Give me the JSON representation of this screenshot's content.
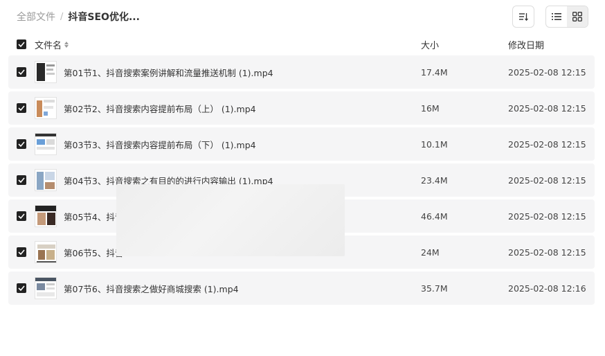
{
  "breadcrumb": {
    "root": "全部文件",
    "separator": "/",
    "current": "抖音SEO优化..."
  },
  "toolbar": {
    "sort_icon": "sort-list-icon",
    "list_icon": "list-view-icon",
    "grid_icon": "grid-view-icon"
  },
  "columns": {
    "name": "文件名",
    "size": "大小",
    "modified": "修改日期"
  },
  "files": [
    {
      "name": "第01节1、抖音搜索案例讲解和流量推送机制 (1).mp4",
      "size": "17.4M",
      "modified": "2025-02-08 12:15"
    },
    {
      "name": "第02节2、抖音搜索内容提前布局（上） (1).mp4",
      "size": "16M",
      "modified": "2025-02-08 12:15"
    },
    {
      "name": "第03节3、抖音搜索内容提前布局（下） (1).mp4",
      "size": "10.1M",
      "modified": "2025-02-08 12:15"
    },
    {
      "name": "第04节3、抖音搜索之有目的的进行内容输出 (1).mp4",
      "size": "23.4M",
      "modified": "2025-02-08 12:15"
    },
    {
      "name": "第05节4、抖音",
      "size": "46.4M",
      "modified": "2025-02-08 12:15"
    },
    {
      "name": "第06节5、抖音",
      "size": "24M",
      "modified": "2025-02-08 12:15"
    },
    {
      "name": "第07节6、抖音搜索之做好商城搜索 (1).mp4",
      "size": "35.7M",
      "modified": "2025-02-08 12:16"
    }
  ],
  "colors": {
    "row_bg": "#f5f5f6",
    "checkbox": "#222222",
    "muted_text": "#9a9a9a"
  }
}
